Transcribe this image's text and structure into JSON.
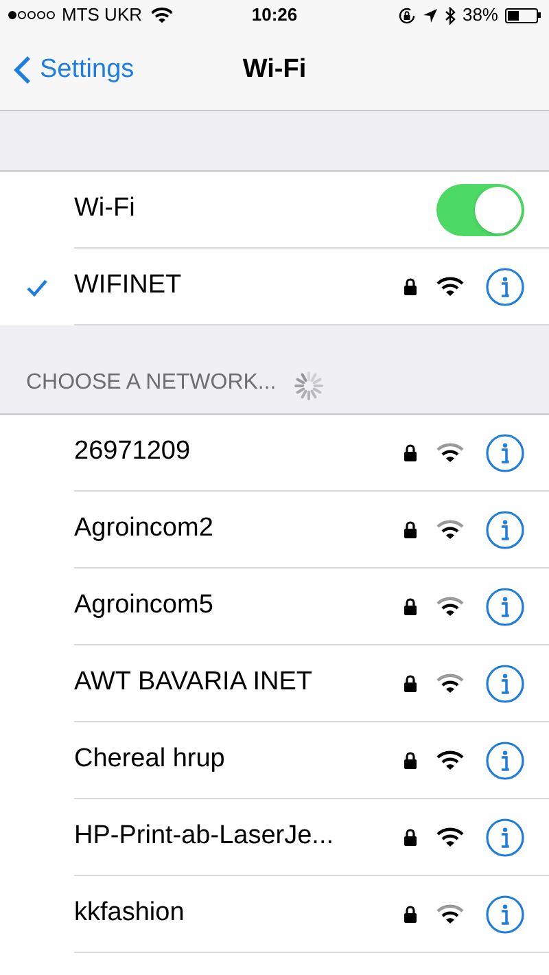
{
  "status_bar": {
    "signal_dots": [
      {
        "filled": true
      },
      {
        "filled": false
      },
      {
        "filled": false
      },
      {
        "filled": false
      },
      {
        "filled": false
      }
    ],
    "carrier": "MTS UKR",
    "time": "10:26",
    "battery_percent": "38%",
    "battery": {
      "level": 0.38
    }
  },
  "nav": {
    "back_label": "Settings",
    "title": "Wi-Fi"
  },
  "wifi_toggle": {
    "label": "Wi-Fi",
    "on": true
  },
  "connected": {
    "name": "WIFINET",
    "selected": true,
    "locked": true,
    "strong_signal": true
  },
  "section_header": "CHOOSE A NETWORK...",
  "networks": [
    {
      "name": "26971209",
      "locked": true,
      "strong_signal": false
    },
    {
      "name": "Agroincom2",
      "locked": true,
      "strong_signal": false
    },
    {
      "name": "Agroincom5",
      "locked": true,
      "strong_signal": false
    },
    {
      "name": "AWT BAVARIA INET",
      "locked": true,
      "strong_signal": false
    },
    {
      "name": "Chereal hrup",
      "locked": true,
      "strong_signal": true
    },
    {
      "name": "HP-Print-ab-LaserJe...",
      "locked": true,
      "strong_signal": true
    },
    {
      "name": "kkfashion",
      "locked": true,
      "strong_signal": false
    }
  ]
}
